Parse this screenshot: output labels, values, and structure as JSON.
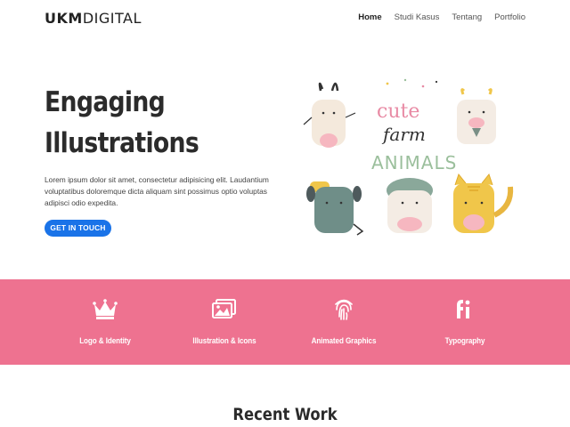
{
  "brand": {
    "logo_bold": "UKM",
    "logo_light": "DIGITAL"
  },
  "nav": {
    "items": [
      "Home",
      "Studi Kasus",
      "Tentang",
      "Portfolio"
    ],
    "active": "Home"
  },
  "hero": {
    "title_line1": "Engaging",
    "title_line2": "Illustrations",
    "body": "Lorem ipsum dolor sit amet, consectetur adipisicing elit. Laudantium voluptatibus doloremque dicta aliquam sint possimus optio voluptas adipisci odio expedita.",
    "cta_label": "GET IN TOUCH",
    "illustration_text": [
      "cute",
      "farm",
      "ANIMALS"
    ]
  },
  "services": [
    {
      "label": "Logo & Identity",
      "icon": "crown-icon"
    },
    {
      "label": "Illustration & Icons",
      "icon": "images-icon"
    },
    {
      "label": "Animated Graphics",
      "icon": "fingerprint-icon"
    },
    {
      "label": "Typography",
      "icon": "typography-icon"
    }
  ],
  "recent": {
    "title": "Recent Work"
  },
  "colors": {
    "band": "#ee7290",
    "cta": "#1a73e8",
    "text": "#2b2b2b"
  }
}
